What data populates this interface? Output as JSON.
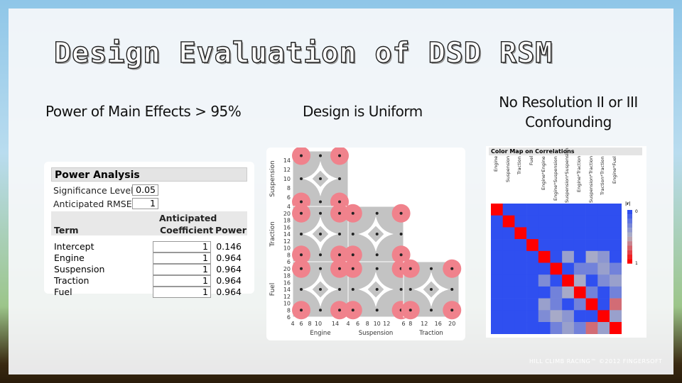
{
  "slide": {
    "title": "Design Evaluation of DSD RSM",
    "headings": [
      "Power of Main Effects > 95%",
      "Design is Uniform",
      "No Resolution II or III Confounding"
    ],
    "watermark": "HILL CLIMB RACING™ ©2012 FINGERSOFT"
  },
  "power": {
    "title": "Power Analysis",
    "significance_label": "Significance Level",
    "significance_value": "0.05",
    "rmse_label": "Anticipated RMSE",
    "rmse_value": "1",
    "columns": {
      "term": "Term",
      "coef_line1": "Anticipated",
      "coef_line2": "Coefficient",
      "power": "Power"
    },
    "rows": [
      {
        "term": "Intercept",
        "coef": "1",
        "power": "0.146"
      },
      {
        "term": "Engine",
        "coef": "1",
        "power": "0.964"
      },
      {
        "term": "Suspension",
        "coef": "1",
        "power": "0.964"
      },
      {
        "term": "Traction",
        "coef": "1",
        "power": "0.964"
      },
      {
        "term": "Fuel",
        "coef": "1",
        "power": "0.964"
      }
    ]
  },
  "scatter": {
    "x_factors": [
      {
        "name": "Engine",
        "ticks": [
          "4",
          "6",
          "8",
          "10",
          "14"
        ],
        "tickvals": [
          4,
          6,
          8,
          10,
          14
        ],
        "range": [
          4,
          17
        ],
        "levels": [
          6,
          10.5,
          15
        ]
      },
      {
        "name": "Suspension",
        "ticks": [
          "4",
          "6",
          "8",
          "10",
          "12"
        ],
        "tickvals": [
          4,
          6,
          8,
          10,
          12
        ],
        "range": [
          4,
          15.5
        ],
        "levels": [
          5,
          10,
          15
        ]
      },
      {
        "name": "Traction",
        "ticks": [
          "6",
          "8",
          "12",
          "16",
          "20"
        ],
        "tickvals": [
          6,
          8,
          12,
          16,
          20
        ],
        "range": [
          6,
          22
        ],
        "levels": [
          8,
          14,
          20
        ]
      }
    ],
    "y_factors": [
      {
        "name": "Suspension",
        "ticks": [
          "4",
          "6",
          "8",
          "10",
          "12",
          "14"
        ],
        "tickvals": [
          4,
          6,
          8,
          10,
          12,
          14
        ],
        "range": [
          4,
          16
        ],
        "levels": [
          5,
          10,
          15
        ]
      },
      {
        "name": "Traction",
        "ticks": [
          "6",
          "8",
          "10",
          "12",
          "14",
          "16",
          "18",
          "20"
        ],
        "tickvals": [
          6,
          8,
          10,
          12,
          14,
          16,
          18,
          20
        ],
        "range": [
          6,
          22
        ],
        "levels": [
          8,
          14,
          20
        ]
      },
      {
        "name": "Fuel",
        "ticks": [
          "6",
          "8",
          "10",
          "12",
          "14",
          "16",
          "18",
          "20"
        ],
        "tickvals": [
          6,
          8,
          10,
          12,
          14,
          16,
          18,
          20
        ],
        "range": [
          6,
          22
        ],
        "levels": [
          8,
          14,
          20
        ]
      }
    ],
    "colors": {
      "gray": "#c3c3c3",
      "pink": "#f0828c",
      "dot": "#222222"
    }
  },
  "corr": {
    "title": "Color Map on Correlations",
    "terms": [
      "Engine",
      "Suspension",
      "Traction",
      "Fuel",
      "Engine*Engine",
      "Engine*Suspension",
      "Suspension*Suspension",
      "Engine*Traction",
      "Suspension*Traction",
      "Traction*Traction",
      "Engine*Fuel"
    ],
    "legend_title": "|r|",
    "legend_min": "0",
    "legend_max": "1",
    "matrix": [
      [
        1,
        0,
        0,
        0,
        0,
        0,
        0,
        0,
        0,
        0,
        0
      ],
      [
        0,
        1,
        0,
        0,
        0,
        0,
        0,
        0,
        0,
        0,
        0
      ],
      [
        0,
        0,
        1,
        0,
        0,
        0,
        0,
        0,
        0,
        0,
        0
      ],
      [
        0,
        0,
        0,
        1,
        0,
        0,
        0,
        0,
        0,
        0,
        0
      ],
      [
        0,
        0,
        0,
        0,
        1,
        0,
        0.4,
        0,
        0.45,
        0.35,
        0
      ],
      [
        0,
        0,
        0,
        0,
        0,
        1,
        0,
        0.25,
        0.25,
        0.4,
        0.25
      ],
      [
        0,
        0,
        0,
        0,
        0.3,
        0,
        1,
        0.45,
        0,
        0.3,
        0.4
      ],
      [
        0,
        0,
        0,
        0,
        0,
        0.25,
        0.45,
        1,
        0.25,
        0,
        0.25
      ],
      [
        0,
        0,
        0,
        0,
        0.4,
        0.25,
        0,
        0.25,
        1,
        0,
        0.7
      ],
      [
        0,
        0,
        0,
        0,
        0.3,
        0.45,
        0.35,
        0,
        0,
        1,
        0.4
      ],
      [
        0,
        0,
        0,
        0,
        0,
        0.25,
        0.4,
        0.25,
        0.7,
        0.4,
        1
      ]
    ]
  }
}
